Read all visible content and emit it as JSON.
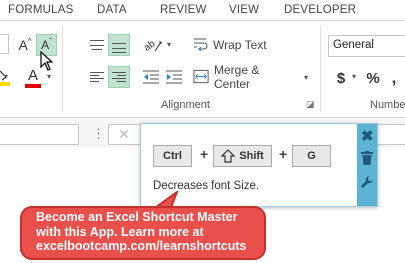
{
  "menu": {
    "tabs": [
      "FORMULAS",
      "DATA",
      "REVIEW",
      "VIEW",
      "DEVELOPER"
    ]
  },
  "font_group": {
    "grow_font": "A",
    "shrink_font": "A",
    "font_color": "A",
    "grow_caret": "^",
    "shrink_caret": "ˇ"
  },
  "alignment": {
    "group_label": "Alignment",
    "wrap_text_label": "Wrap Text",
    "merge_center_label": "Merge & Center",
    "orientation_icon": "ab-arrow-icon"
  },
  "number": {
    "format_value": "General",
    "group_label": "Numbe",
    "currency_symbol": "$",
    "percent_symbol": "%",
    "comma_symbol": ","
  },
  "formula_bar": {
    "menu_dots": "⋮",
    "cancel_symbol": "✕"
  },
  "shortcut_tip": {
    "keys": [
      "Ctrl",
      "Shift",
      "G"
    ],
    "separator": "+",
    "description": "Decreases font Size."
  },
  "promo": {
    "lines": [
      "Become an Excel Shortcut Master",
      "with this App. Learn more at",
      "excelbootcamp.com/learnshortcuts"
    ]
  },
  "colors": {
    "accent_green": "#bfe3cf",
    "font_color_bar": "#e00000",
    "tip_sidebar": "#5cb3d4",
    "promo_fill": "#e94f4b"
  }
}
